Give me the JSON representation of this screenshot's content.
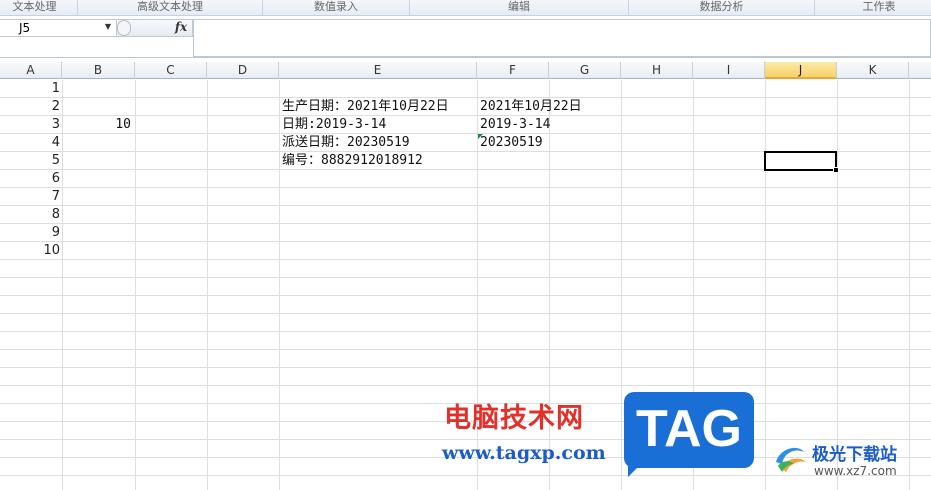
{
  "ribbon": {
    "groups": [
      "文本处理",
      "高级文本处理",
      "数值录入",
      "编辑",
      "数据分析",
      "工作表"
    ]
  },
  "formula_bar": {
    "name_box": "J5",
    "fx_label": "fx",
    "formula": ""
  },
  "sheet": {
    "columns": [
      "A",
      "B",
      "C",
      "D",
      "E",
      "F",
      "G",
      "H",
      "I",
      "J",
      "K"
    ],
    "selected_column": "J",
    "active_cell": "J5",
    "rows": [
      "1",
      "2",
      "3",
      "4",
      "5",
      "6",
      "7",
      "8",
      "9",
      "10"
    ],
    "cells": {
      "B3": "10",
      "E2": "生产日期：2021年10月22日",
      "E3": "日期:2019-3-14",
      "E4": "派送日期：20230519",
      "E5": "编号：8882912018912",
      "F2": "2021年10月22日",
      "F3": "2019-3-14",
      "F4": "20230519"
    }
  },
  "watermark": {
    "site_name": "电脑技术网",
    "site_url": "www.tagxp.com",
    "tag": "TAG",
    "xz_name": "极光下载站",
    "xz_url": "www.xz7.com"
  },
  "colors": {
    "selected_header": "#f8d26a",
    "error_indicator": "#1f8a3a",
    "site_red": "#e3302a",
    "site_blue": "#1c5cc8",
    "tag_blue": "#1a6fd6"
  }
}
